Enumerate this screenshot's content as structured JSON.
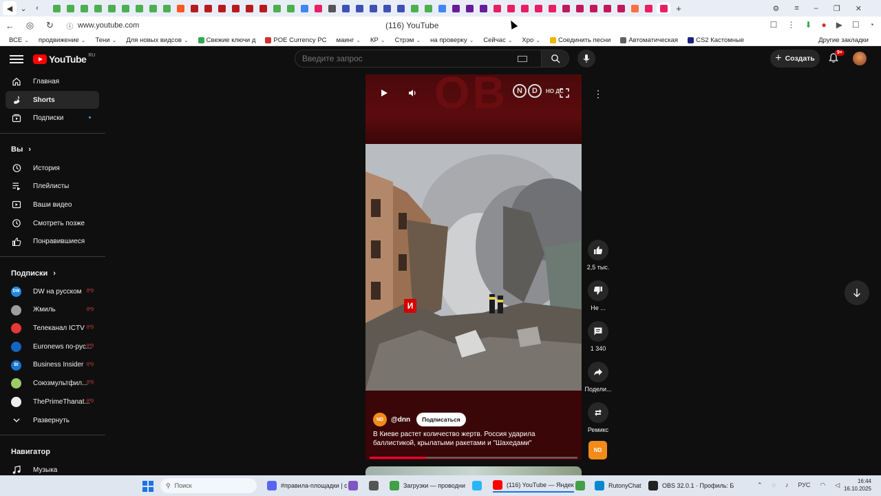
{
  "browser": {
    "url": "www.youtube.com",
    "tab_title": "(116) YouTube",
    "tab_colors": [
      "#4caf50",
      "#4caf50",
      "#4caf50",
      "#4caf50",
      "#4caf50",
      "#4caf50",
      "#4caf50",
      "#4caf50",
      "#4caf50",
      "#ff5722",
      "#b71c1c",
      "#b71c1c",
      "#b71c1c",
      "#b71c1c",
      "#b71c1c",
      "#b71c1c",
      "#4caf50",
      "#4caf50",
      "#4285f4",
      "#e91e63",
      "#555555",
      "#3f51b5",
      "#3f51b5",
      "#3f51b5",
      "#3f51b5",
      "#3f51b5",
      "#4caf50",
      "#4caf50",
      "#4285f4",
      "#6a1b9a",
      "#6a1b9a",
      "#6a1b9a",
      "#e91e63",
      "#e91e63",
      "#e91e63",
      "#e91e63",
      "#e91e63",
      "#c2185b",
      "#c2185b",
      "#c2185b",
      "#c2185b",
      "#c2185b",
      "#ff7043",
      "#e91e63",
      "#e91e63"
    ],
    "bookmarks": [
      {
        "label": "ВСЕ",
        "chev": true
      },
      {
        "label": "продвижение",
        "chev": true
      },
      {
        "label": "Тени",
        "chev": true
      },
      {
        "label": "Для новых видсов",
        "chev": true
      },
      {
        "label": "Свежие ключи д",
        "chev": false,
        "color": "#34a853"
      },
      {
        "label": "POE Currency PC",
        "chev": false,
        "color": "#d32f2f"
      },
      {
        "label": "маинг",
        "chev": true
      },
      {
        "label": "КР",
        "chev": true
      },
      {
        "label": "Стрэм",
        "chev": true
      },
      {
        "label": "на проверку",
        "chev": true
      },
      {
        "label": "Сейчас",
        "chev": true
      },
      {
        "label": "Хро",
        "chev": true
      },
      {
        "label": "Соединить песни",
        "chev": false,
        "color": "#f4b400"
      },
      {
        "label": "Автоматическая",
        "chev": false,
        "color": "#5f6368"
      },
      {
        "label": "CS2 Кастомные",
        "chev": false,
        "color": "#1a237e"
      }
    ],
    "other_bookmarks": "Другие закладки"
  },
  "header": {
    "logo_text": "YouTube",
    "logo_region": "RU",
    "search_placeholder": "Введите запрос",
    "create_label": "Создать",
    "notifications_badge": "9+"
  },
  "sidebar": {
    "main": [
      {
        "label": "Главная",
        "icon": "home-icon"
      },
      {
        "label": "Shorts",
        "icon": "shorts-icon",
        "active": true
      },
      {
        "label": "Подписки",
        "icon": "subscriptions-icon",
        "dot": true
      }
    ],
    "you_title": "Вы",
    "you": [
      {
        "label": "История",
        "icon": "history-icon"
      },
      {
        "label": "Плейлисты",
        "icon": "playlists-icon"
      },
      {
        "label": "Ваши видео",
        "icon": "your-videos-icon"
      },
      {
        "label": "Смотреть позже",
        "icon": "watch-later-icon"
      },
      {
        "label": "Понравившиеся",
        "icon": "liked-icon"
      }
    ],
    "subs_title": "Подписки",
    "subscriptions": [
      {
        "label": "DW на русском",
        "color": "#1e88e5",
        "abbr": "DW"
      },
      {
        "label": "Жмиль",
        "color": "#9e9e9e",
        "abbr": ""
      },
      {
        "label": "Телеканал ICTV",
        "color": "#e53935",
        "abbr": ""
      },
      {
        "label": "Euronews по-рус...",
        "color": "#1565c0",
        "abbr": ""
      },
      {
        "label": "Business Insider",
        "color": "#1976d2",
        "abbr": "BI"
      },
      {
        "label": "Союзмультфил...",
        "color": "#9ccc65",
        "abbr": ""
      },
      {
        "label": "ThePrimeThanat...",
        "color": "#eeeeee",
        "abbr": ""
      }
    ],
    "expand_label": "Развернуть",
    "navigator_title": "Навигатор",
    "navigator": [
      {
        "label": "Музыка",
        "icon": "music-icon"
      }
    ]
  },
  "short": {
    "channel_handle": "@dnn",
    "subscribe_label": "Подписаться",
    "caption": "В Киеве растет количество жертв. Россия ударила баллистикой, крылатыми ракетами и \"Шахедами\"",
    "progress": 0.27,
    "badge_letter": "И",
    "nd_text": "НО ДС"
  },
  "actions": {
    "likes": "2,5 тыс.",
    "dislike_label": "Не ...",
    "comments": "1 340",
    "share_label": "Подели...",
    "remix_label": "Ремикс"
  },
  "taskbar": {
    "search_label": "Поиск",
    "apps": [
      {
        "label": "#правила-площадки | с",
        "color": "#5865f2"
      },
      {
        "label": "",
        "color": "#7e57c2"
      },
      {
        "label": "",
        "color": "#555555"
      },
      {
        "label": "Загрузки — проводни",
        "color": "#43a047"
      },
      {
        "label": "",
        "color": "#29b6f6"
      },
      {
        "label": "(116) YouTube — Яндек",
        "color": "#ff0000",
        "active": true
      },
      {
        "label": "",
        "color": "#43a047"
      },
      {
        "label": "RutonyChat",
        "color": "#0288d1"
      },
      {
        "label": "OBS 32.0.1 · Профиль: Б",
        "color": "#222222"
      }
    ],
    "lang": "РУС",
    "time": "16:44",
    "date": "16.10.2025"
  }
}
